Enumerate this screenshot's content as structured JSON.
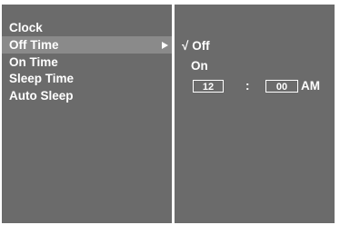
{
  "menu": {
    "items": [
      {
        "label": "Clock"
      },
      {
        "label": "Off Time"
      },
      {
        "label": "On Time"
      },
      {
        "label": "Sleep Time"
      },
      {
        "label": "Auto Sleep"
      }
    ],
    "selected_index": 1
  },
  "submenu": {
    "check_mark": "√",
    "off_label": "Off",
    "on_label": "On",
    "hour": "12",
    "separator": ":",
    "minute": "00",
    "meridiem": "AM"
  },
  "colors": {
    "panel_bg": "#6b6b6b",
    "selected_bg": "#8a8a8a",
    "text": "#ffffff"
  }
}
